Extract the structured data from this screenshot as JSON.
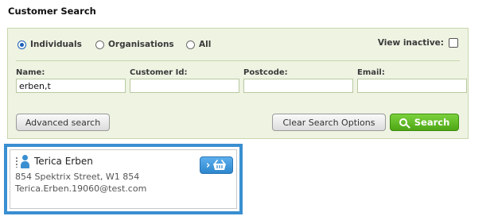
{
  "page": {
    "title": "Customer Search"
  },
  "filters": {
    "individuals": "Individuals",
    "organisations": "Organisations",
    "all": "All",
    "selected": "Individuals",
    "view_inactive": "View inactive:"
  },
  "fields": {
    "name": {
      "label": "Name:",
      "value": "erben,t"
    },
    "customer_id": {
      "label": "Customer Id:",
      "value": ""
    },
    "postcode": {
      "label": "Postcode:",
      "value": ""
    },
    "email": {
      "label": "Email:",
      "value": ""
    }
  },
  "buttons": {
    "advanced": "Advanced search",
    "clear": "Clear Search Options",
    "search": "Search"
  },
  "result": {
    "name": "Terica Erben",
    "address": "854 Spektrix Street, W1 854",
    "email": "Terica.Erben.19060@test.com"
  },
  "colors": {
    "panel_bg": "#eef3e2",
    "search_button": "#5cb827",
    "highlight_border": "#3a8fd0"
  }
}
